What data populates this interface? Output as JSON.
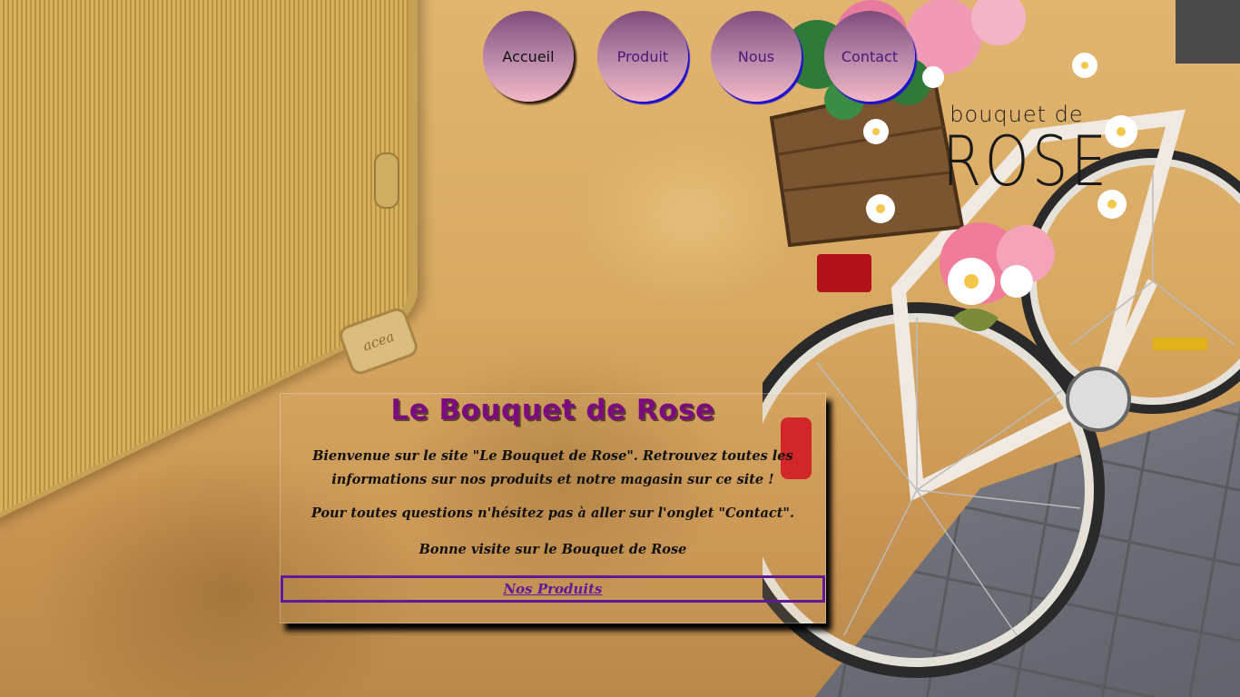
{
  "nav": {
    "items": [
      {
        "label": "Accueil"
      },
      {
        "label": "Produit"
      },
      {
        "label": "Nous"
      },
      {
        "label": "Contact"
      }
    ]
  },
  "logo": {
    "line1": "bouquet de",
    "line2": "ROSE"
  },
  "background": {
    "plate_text": "acea"
  },
  "card": {
    "title": "Le Bouquet de Rose",
    "paragraph1": "Bienvenue sur le site \"Le Bouquet de Rose\". Retrouvez toutes les informations sur nos produits et notre magasin sur ce site !",
    "paragraph2": "Pour toutes questions n'hésitez pas à aller sur l'onglet \"Contact\".",
    "paragraph3": "Bonne visite sur le Bouquet de Rose",
    "cta_label": "Nos Produits"
  },
  "colors": {
    "title": "#7b0b7e",
    "cta": "#5f1a9c",
    "nav_text": "#4a1a7a"
  }
}
